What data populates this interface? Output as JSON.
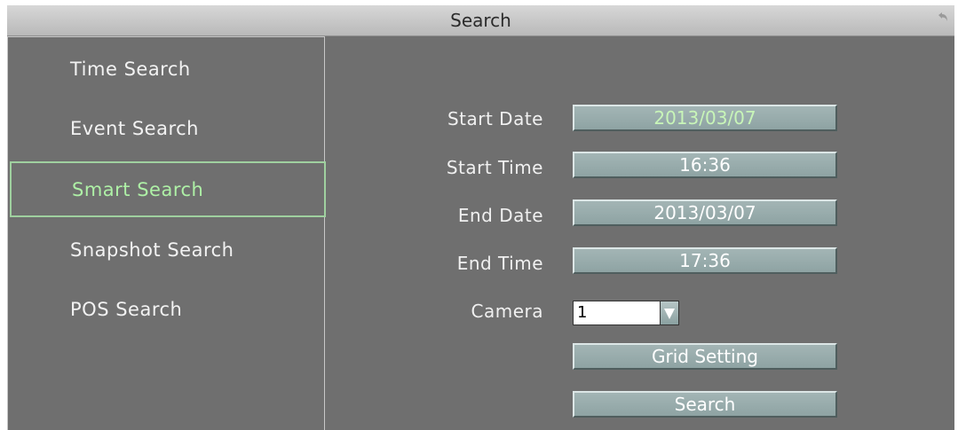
{
  "window": {
    "title": "Search"
  },
  "sidebar": {
    "items": [
      {
        "label": "Time Search",
        "active": false
      },
      {
        "label": "Event Search",
        "active": false
      },
      {
        "label": "Smart Search",
        "active": true
      },
      {
        "label": "Snapshot Search",
        "active": false
      },
      {
        "label": "POS Search",
        "active": false
      }
    ]
  },
  "form": {
    "start_date_label": "Start Date",
    "start_date_value": "2013/03/07",
    "start_time_label": "Start Time",
    "start_time_value": "16:36",
    "end_date_label": "End Date",
    "end_date_value": "2013/03/07",
    "end_time_label": "End Time",
    "end_time_value": "17:36",
    "camera_label": "Camera",
    "camera_value": "1",
    "grid_setting_label": "Grid Setting",
    "search_button_label": "Search"
  },
  "colors": {
    "panel_background": "#6f6f6f",
    "field_background": "#9aaeae",
    "active_highlight": "#aef0a6"
  },
  "icons": {
    "back": "back-arrow-icon",
    "dropdown": "dropdown-triangle-icon"
  }
}
